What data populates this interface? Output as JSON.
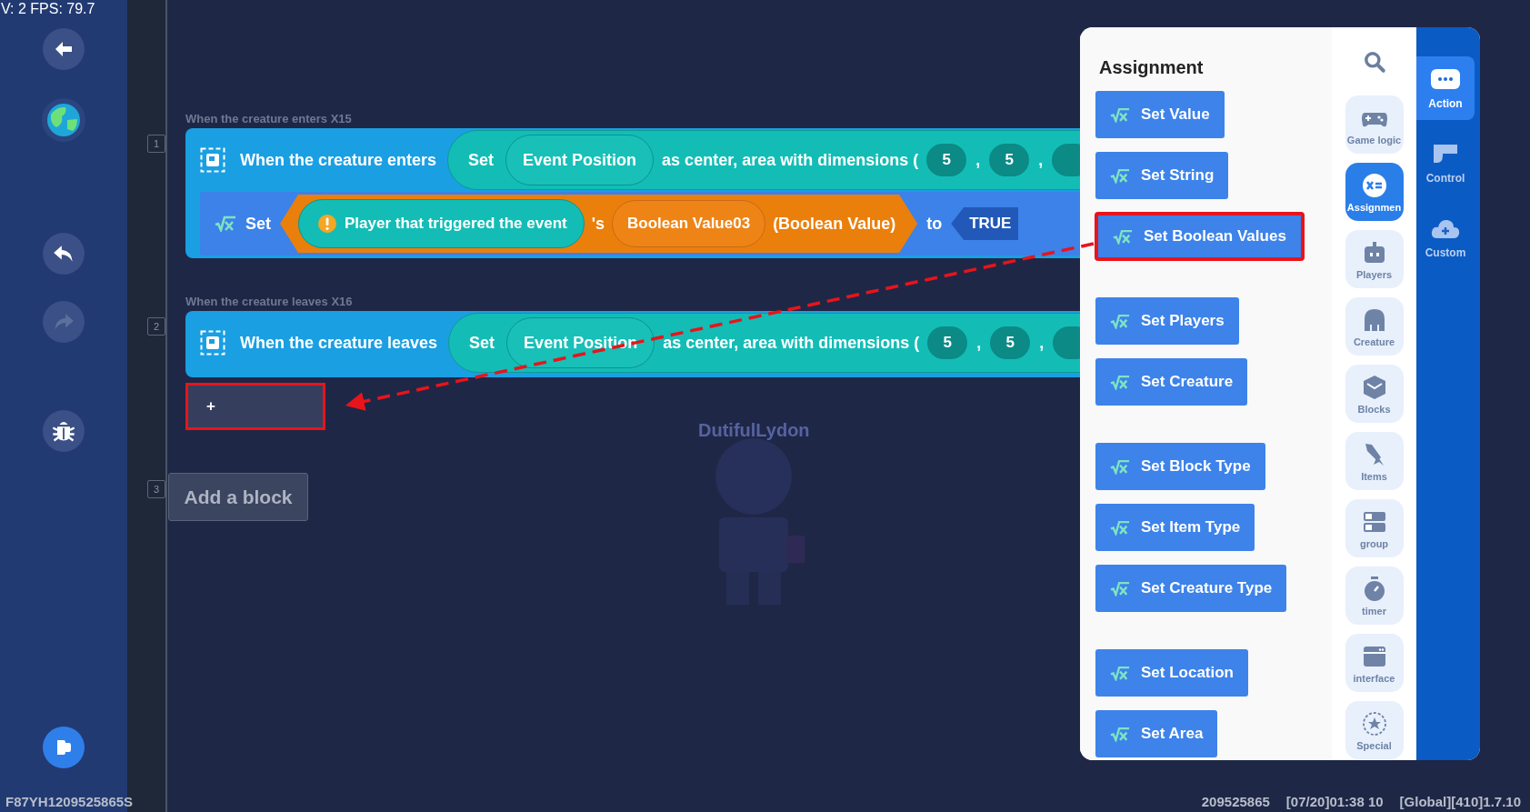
{
  "hud": {
    "stats": "V: 2 FPS: 79.7"
  },
  "sidebar": [
    {
      "kind": "back",
      "disabled": false
    },
    {
      "kind": "world",
      "disabled": false
    },
    {
      "kind": "undo",
      "disabled": false
    },
    {
      "kind": "redo",
      "disabled": true
    },
    {
      "kind": "debug",
      "disabled": false
    },
    {
      "kind": "run",
      "disabled": false
    }
  ],
  "scripts": [
    {
      "number": "1",
      "label": "When the creature enters X15",
      "event": {
        "title": "When the creature enters",
        "set": "Set",
        "position": "Event Position",
        "area_text": "as center, area with dimensions (",
        "dims": [
          {
            "value": "5",
            "separator": ","
          },
          {
            "value": "5",
            "separator": ","
          }
        ]
      },
      "actions": [
        {
          "kind": "set",
          "set": "Set",
          "player": "Player that triggered the event",
          "possessive": "'s",
          "variable": "Boolean Value03",
          "type": "(Boolean Value)",
          "to": "to",
          "value": "TRUE"
        }
      ]
    },
    {
      "number": "2",
      "label": "When the creature leaves X16",
      "event": {
        "title": "When the creature leaves",
        "set": "Set",
        "position": "Event Position",
        "area_text": "as center, area with dimensions (",
        "dims": [
          {
            "value": "5",
            "separator": ","
          },
          {
            "value": "5",
            "separator": ","
          }
        ]
      },
      "slot": {
        "label": "+",
        "highlighted": true
      }
    }
  ],
  "add_block": {
    "number": "3",
    "label": "Add a block"
  },
  "character": {
    "name": "DutifulLydon"
  },
  "panel": {
    "title": "Assignment",
    "groups": [
      [
        {
          "label": "Set Value",
          "highlighted": false
        },
        {
          "label": "Set String",
          "highlighted": false
        },
        {
          "label": "Set Boolean Values",
          "highlighted": true
        }
      ],
      [
        {
          "label": "Set Players",
          "highlighted": false
        },
        {
          "label": "Set Creature",
          "highlighted": false
        }
      ],
      [
        {
          "label": "Set Block Type",
          "highlighted": false
        },
        {
          "label": "Set Item Type",
          "highlighted": false
        },
        {
          "label": "Set Creature Type",
          "highlighted": false
        }
      ],
      [
        {
          "label": "Set Location",
          "highlighted": false
        },
        {
          "label": "Set Area",
          "highlighted": false
        }
      ]
    ],
    "categories": [
      {
        "kind": "game",
        "label": "Game logic",
        "selected": false
      },
      {
        "kind": "assign",
        "label": "Assignmen",
        "selected": true
      },
      {
        "kind": "players",
        "label": "Players",
        "selected": false
      },
      {
        "kind": "creature",
        "label": "Creature",
        "selected": false
      },
      {
        "kind": "blocks",
        "label": "Blocks",
        "selected": false
      },
      {
        "kind": "items",
        "label": "Items",
        "selected": false
      },
      {
        "kind": "group",
        "label": "group",
        "selected": false
      },
      {
        "kind": "timer",
        "label": "timer",
        "selected": false
      },
      {
        "kind": "interface",
        "label": "interface",
        "selected": false
      },
      {
        "kind": "effect",
        "label": "Special",
        "selected": false
      }
    ],
    "tabs": [
      {
        "kind": "action",
        "label": "Action",
        "selected": true
      },
      {
        "kind": "control",
        "label": "Control",
        "selected": false
      },
      {
        "kind": "custom",
        "label": "Custom",
        "selected": false
      }
    ]
  },
  "footer": {
    "device": "F87YH1209525865S",
    "id": "209525865",
    "time": "[07/20]01:38 10",
    "build": "[Global][410]1.7.10"
  }
}
